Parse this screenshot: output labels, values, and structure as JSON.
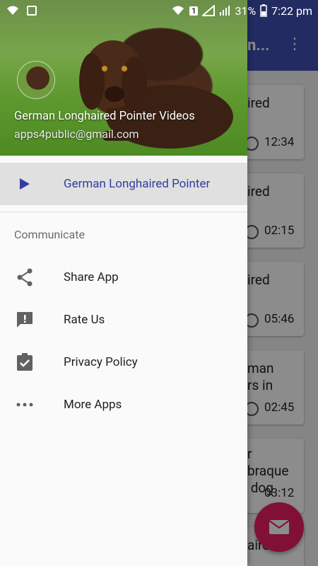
{
  "status_bar": {
    "battery": "31%",
    "time": "7:22 pm",
    "sim_badge": "1"
  },
  "background_app": {
    "title_fragment": "n...",
    "cards": [
      {
        "title": "ired",
        "time": "12:34"
      },
      {
        "title": "ired",
        "time": "02:15"
      },
      {
        "title": "ired",
        "time": "05:46"
      },
      {
        "title": "man\nrs in",
        "time": "02:45"
      },
      {
        "title": "r\nbraque\n dog",
        "time": "03:12"
      },
      {
        "title": "aire",
        "time": ""
      }
    ]
  },
  "drawer": {
    "header": {
      "app_name": "German Longhaired Pointer Videos",
      "email": "apps4public@gmail.com"
    },
    "primary_item": {
      "label": "German Longhaired Pointer",
      "icon": "play-icon"
    },
    "section_title": "Communicate",
    "items": [
      {
        "label": "Share App",
        "icon": "share-icon"
      },
      {
        "label": "Rate Us",
        "icon": "feedback-icon"
      },
      {
        "label": "Privacy Policy",
        "icon": "assignment-check-icon"
      },
      {
        "label": "More Apps",
        "icon": "more-horiz-icon"
      }
    ]
  },
  "colors": {
    "primary": "#3f51b5",
    "active_text": "#303f9f",
    "fab": "#e91e63"
  }
}
